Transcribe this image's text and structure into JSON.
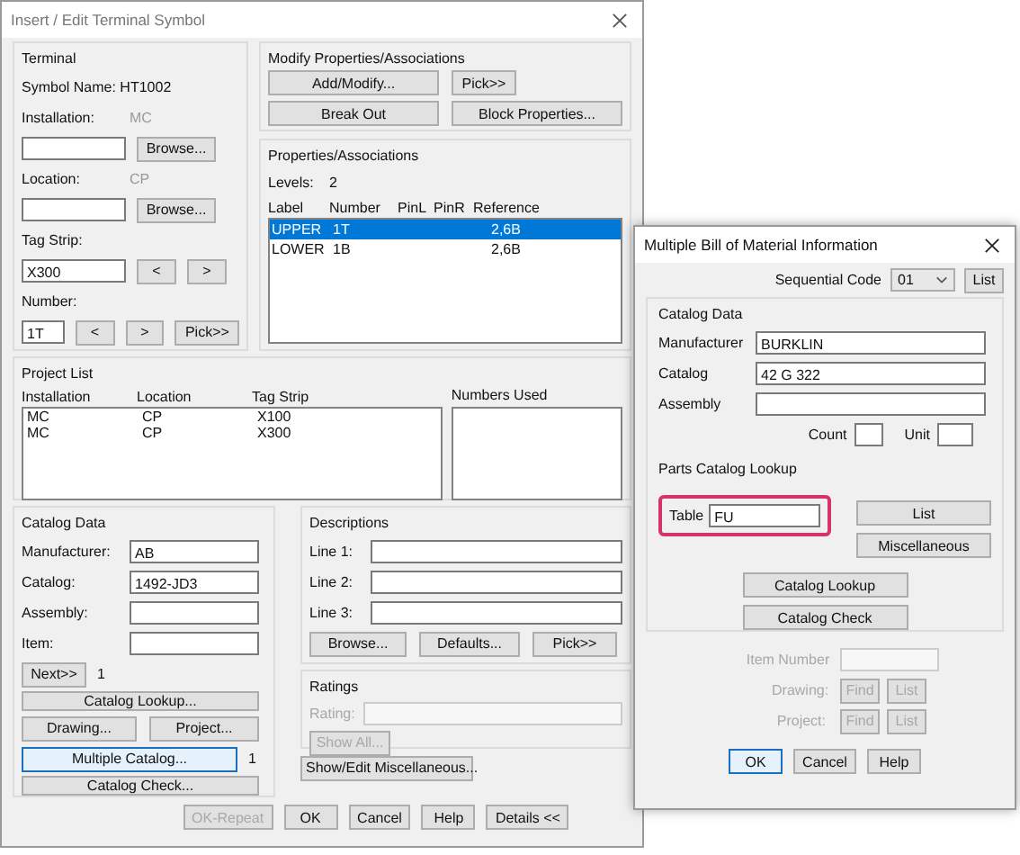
{
  "main": {
    "title": "Insert / Edit Terminal Symbol",
    "terminal": {
      "title": "Terminal",
      "symbol_name": "Symbol Name: HT1002",
      "installation": {
        "label": "Installation:",
        "value": "MC",
        "browse": "Browse..."
      },
      "location": {
        "label": "Location:",
        "value": "CP",
        "browse": "Browse..."
      },
      "tag_strip": {
        "label": "Tag Strip:",
        "value": "X300",
        "prev": "<",
        "next": ">"
      },
      "number": {
        "label": "Number:",
        "value": "1T",
        "prev": "<",
        "next": ">",
        "pick": "Pick>>"
      }
    },
    "modify": {
      "title": "Modify Properties/Associations",
      "buttons": [
        "Add/Modify...",
        "Pick>>",
        "Break Out",
        "Block Properties..."
      ]
    },
    "properties": {
      "title": "Properties/Associations",
      "levels_label": "Levels:",
      "levels_value": "2",
      "columns": [
        "Label",
        "Number",
        "PinL",
        "PinR",
        "Reference"
      ],
      "rows": [
        {
          "label": "UPPER",
          "number": "1T",
          "reference": "2,6B",
          "selected": true
        },
        {
          "label": "LOWER",
          "number": "1B",
          "reference": "2,6B",
          "selected": false
        }
      ]
    },
    "project_list": {
      "title": "Project List",
      "columns": [
        "Installation",
        "Location",
        "Tag Strip"
      ],
      "numbers_used": "Numbers Used",
      "rows": [
        {
          "installation": "MC",
          "location": "CP",
          "tag_strip": "X100"
        },
        {
          "installation": "MC",
          "location": "CP",
          "tag_strip": "X300"
        }
      ]
    },
    "catalog_data": {
      "title": "Catalog Data",
      "fields": [
        {
          "label": "Manufacturer:",
          "value": "AB"
        },
        {
          "label": "Catalog:",
          "value": "1492-JD3"
        },
        {
          "label": "Assembly:"
        },
        {
          "label": "Item:"
        }
      ],
      "next_button": "Next>>",
      "next_count": "1",
      "catalog_lookup": "Catalog Lookup...",
      "drawing": "Drawing...",
      "project": "Project...",
      "multiple_catalog": {
        "label": "Multiple Catalog...",
        "focused": true
      },
      "multiple_count": "1",
      "catalog_check": "Catalog Check..."
    },
    "descriptions": {
      "title": "Descriptions",
      "lines": [
        {
          "label": "Line 1:"
        },
        {
          "label": "Line 2:"
        },
        {
          "label": "Line 3:"
        }
      ],
      "buttons": [
        "Browse...",
        "Defaults...",
        "Pick>>"
      ]
    },
    "ratings": {
      "title": "Ratings",
      "rating_label": "Rating:",
      "show_all": "Show All...",
      "disabled": true
    },
    "show_edit_misc": "Show/Edit Miscellaneous...",
    "footer": [
      {
        "label": "OK-Repeat",
        "disabled": true
      },
      {
        "label": "OK",
        "disabled": false
      },
      {
        "label": "Cancel",
        "disabled": false
      },
      {
        "label": "Help",
        "disabled": false
      },
      {
        "label": "Details <<",
        "disabled": false
      }
    ]
  },
  "bom": {
    "title": "Multiple Bill of Material Information",
    "sequential_code_label": "Sequential Code",
    "sequential_code_value": "01",
    "list_button": "List",
    "catalog_data": {
      "title": "Catalog Data",
      "fields": [
        {
          "label": "Manufacturer",
          "value": "BURKLIN"
        },
        {
          "label": "Catalog",
          "value": "42 G 322"
        },
        {
          "label": "Assembly"
        }
      ],
      "count_label": "Count",
      "unit_label": "Unit"
    },
    "parts_lookup": {
      "title": "Parts Catalog Lookup",
      "table_label": "Table",
      "table_value": "FU",
      "highlighted": true,
      "list_button": "List",
      "misc_button": "Miscellaneous",
      "catalog_lookup": "Catalog Lookup",
      "catalog_check": "Catalog Check"
    },
    "item_number_label": "Item Number",
    "item_disabled": true,
    "locate": [
      {
        "label": "Drawing:",
        "find": "Find",
        "list": "List"
      },
      {
        "label": "Project:",
        "find": "Find",
        "list": "List"
      }
    ],
    "footer": [
      {
        "label": "OK",
        "focused": true
      },
      {
        "label": "Cancel",
        "focused": false
      },
      {
        "label": "Help",
        "focused": false
      }
    ]
  }
}
